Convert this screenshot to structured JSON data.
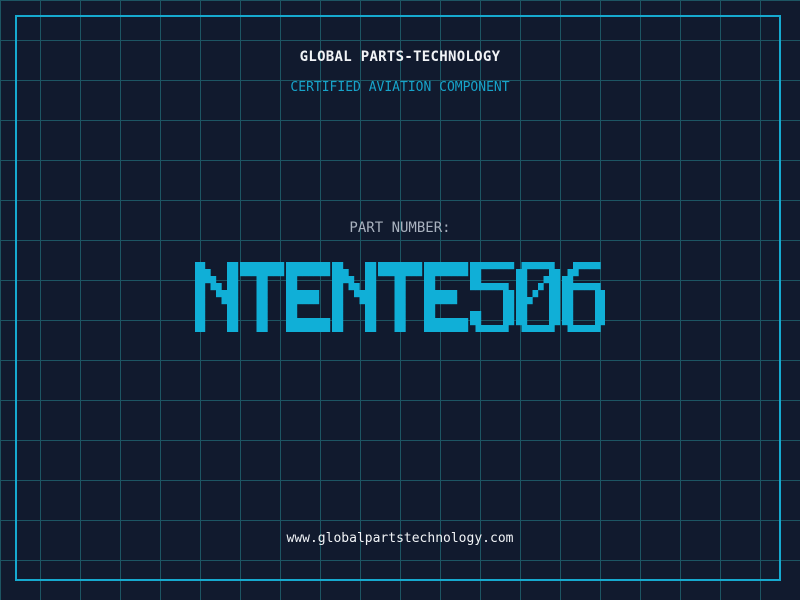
{
  "header": {
    "company_name": "GLOBAL PARTS-TECHNOLOGY",
    "subtitle": "CERTIFIED AVIATION COMPONENT"
  },
  "part": {
    "label": "PART NUMBER:",
    "number": "NTENTE506"
  },
  "footer": {
    "website": "www.globalpartstechnology.com"
  },
  "colors": {
    "background": "#111a2e",
    "grid_line": "#1d5563",
    "frame": "#16a9cf",
    "accent": "#17a3c9",
    "heading_text": "#f1f3f6",
    "label_text": "#aab2bf",
    "part_number": "#10afd7"
  }
}
